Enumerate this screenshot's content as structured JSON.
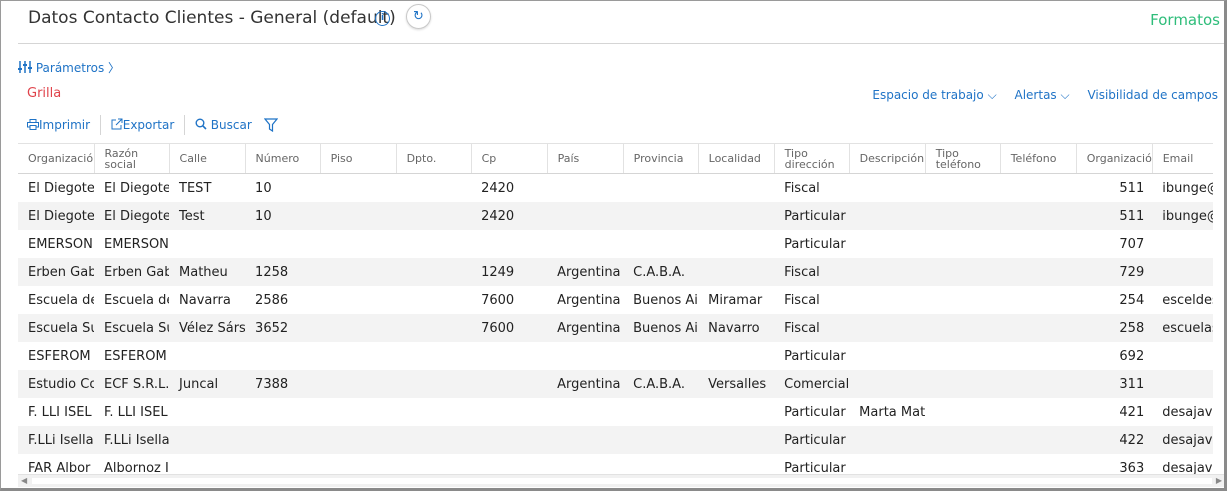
{
  "header": {
    "title": "Datos Contacto Clientes - General (default)",
    "formatos": "Formatos"
  },
  "params": {
    "label": "Parámetros"
  },
  "section": {
    "title": "Grilla"
  },
  "right_links": [
    "Espacio de trabajo",
    "Alertas",
    "Visibilidad de campos"
  ],
  "toolbar": {
    "print": "Imprimir",
    "export": "Exportar",
    "search": "Buscar"
  },
  "table": {
    "columns": [
      {
        "l1": "Organizació",
        "l2": ""
      },
      {
        "l1": "Razón",
        "l2": "social"
      },
      {
        "l1": "Calle",
        "l2": ""
      },
      {
        "l1": "Número",
        "l2": ""
      },
      {
        "l1": "Piso",
        "l2": ""
      },
      {
        "l1": "Dpto.",
        "l2": ""
      },
      {
        "l1": "Cp",
        "l2": ""
      },
      {
        "l1": "País",
        "l2": ""
      },
      {
        "l1": "Provincia",
        "l2": ""
      },
      {
        "l1": "Localidad",
        "l2": ""
      },
      {
        "l1": "Tipo",
        "l2": "dirección"
      },
      {
        "l1": "Descripción",
        "l2": ""
      },
      {
        "l1": "Tipo",
        "l2": "teléfono"
      },
      {
        "l1": "Teléfono",
        "l2": ""
      },
      {
        "l1": "Organizació",
        "l2": ""
      },
      {
        "l1": "Email",
        "l2": ""
      }
    ],
    "rows": [
      [
        "El Diegote",
        "El Diegote",
        "TEST",
        "10",
        "",
        "",
        "2420",
        "",
        "",
        "",
        "Fiscal",
        "",
        "",
        "",
        "511",
        "ibunge@f"
      ],
      [
        "El Diegote",
        "El Diegote",
        "Test",
        "10",
        "",
        "",
        "2420",
        "",
        "",
        "",
        "Particular",
        "",
        "",
        "",
        "511",
        "ibunge@f"
      ],
      [
        "EMERSON",
        "EMERSON",
        "",
        "",
        "",
        "",
        "",
        "",
        "",
        "",
        "Particular",
        "",
        "",
        "",
        "707",
        ""
      ],
      [
        "Erben Gab",
        "Erben Gab",
        "Matheu",
        "1258",
        "",
        "",
        "1249",
        "Argentina",
        "C.A.B.A.",
        "",
        "Fiscal",
        "",
        "",
        "",
        "729",
        ""
      ],
      [
        "Escuela de",
        "Escuela de",
        "Navarra",
        "2586",
        "",
        "",
        "7600",
        "Argentina",
        "Buenos Ai",
        "Miramar",
        "Fiscal",
        "",
        "",
        "",
        "254",
        "esceldes"
      ],
      [
        "Escuela Su",
        "Escuela Su",
        "Vélez Sárs",
        "3652",
        "",
        "",
        "7600",
        "Argentina",
        "Buenos Ai",
        "Navarro",
        "Fiscal",
        "",
        "",
        "",
        "258",
        "escuelasu"
      ],
      [
        "ESFEROM",
        "ESFEROM",
        "",
        "",
        "",
        "",
        "",
        "",
        "",
        "",
        "Particular",
        "",
        "",
        "",
        "692",
        ""
      ],
      [
        "Estudio Co",
        "ECF S.R.L.",
        "Juncal",
        "7388",
        "",
        "",
        "",
        "Argentina",
        "C.A.B.A.",
        "Versalles",
        "Comercial",
        "",
        "",
        "",
        "311",
        ""
      ],
      [
        "F. LLI ISEL",
        "F. LLI ISEL",
        "",
        "",
        "",
        "",
        "",
        "",
        "",
        "",
        "Particular",
        "Marta Mat",
        "",
        "",
        "421",
        "desajavafi"
      ],
      [
        "F.LLi Isella",
        "F.LLi Isella",
        "",
        "",
        "",
        "",
        "",
        "",
        "",
        "",
        "Particular",
        "",
        "",
        "",
        "422",
        "desajavafi"
      ],
      [
        "FAR Albor",
        "Albornoz I",
        "",
        "",
        "",
        "",
        "",
        "",
        "",
        "",
        "Particular",
        "",
        "",
        "",
        "363",
        "desajavafi"
      ]
    ]
  }
}
